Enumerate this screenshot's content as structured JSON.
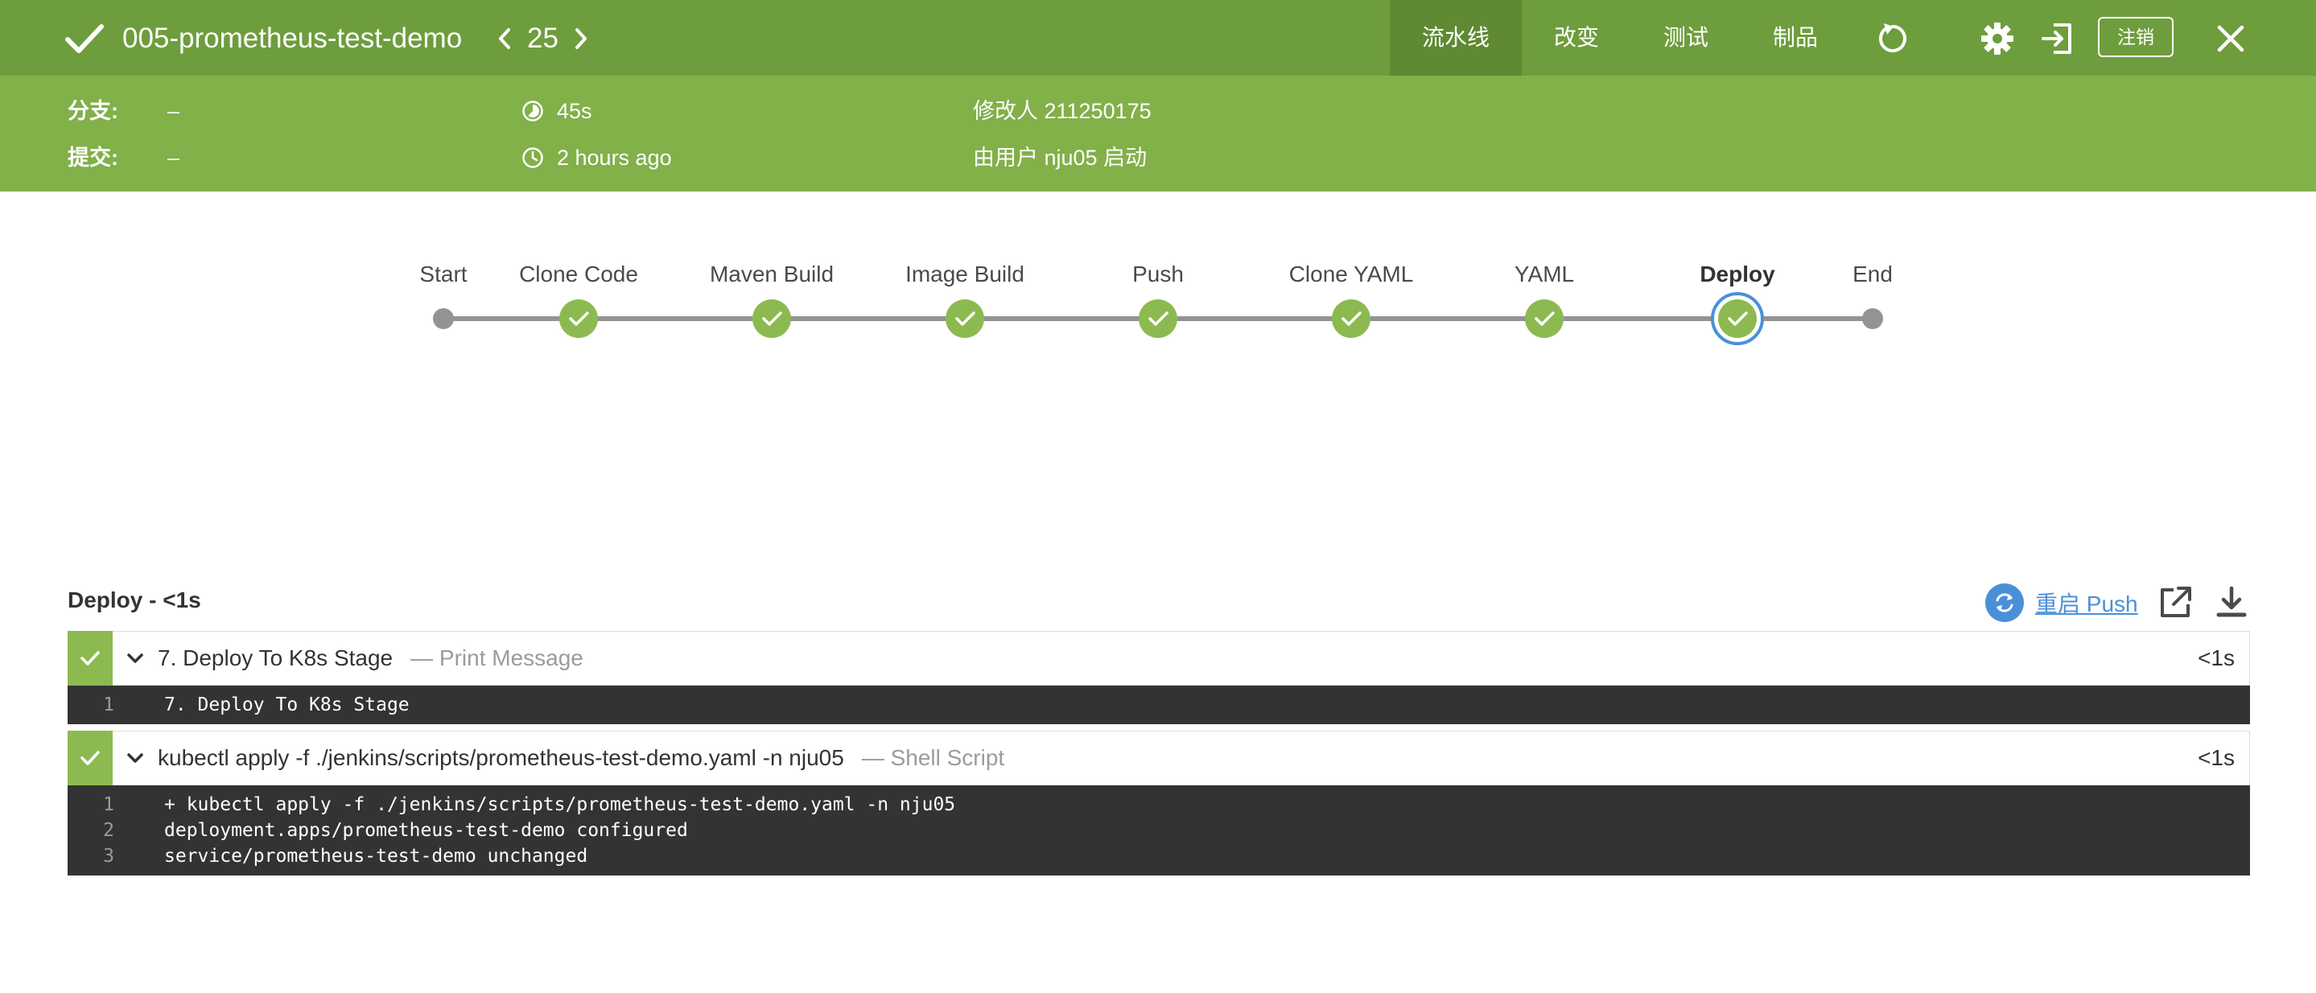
{
  "header": {
    "run_name": "005-prometheus-test-demo",
    "run_number": "25",
    "tabs": [
      {
        "label": "流水线",
        "active": true
      },
      {
        "label": "改变",
        "active": false
      },
      {
        "label": "测试",
        "active": false
      },
      {
        "label": "制品",
        "active": false
      }
    ],
    "logout_label": "注销",
    "icons": [
      "check-icon",
      "chevron-left-icon",
      "chevron-right-icon",
      "replay-icon",
      "gear-icon",
      "exit-icon",
      "close-icon"
    ]
  },
  "summary": {
    "branch_label": "分支:",
    "branch_value": "–",
    "commit_label": "提交:",
    "commit_value": "–",
    "duration": "45s",
    "started": "2 hours ago",
    "changed_by": "修改人 211250175",
    "started_by": "由用户 nju05 启动"
  },
  "pipeline": {
    "stages": [
      {
        "label": "Start",
        "status": "start"
      },
      {
        "label": "Clone Code",
        "status": "success"
      },
      {
        "label": "Maven Build",
        "status": "success"
      },
      {
        "label": "Image Build",
        "status": "success"
      },
      {
        "label": "Push",
        "status": "success"
      },
      {
        "label": "Clone YAML",
        "status": "success"
      },
      {
        "label": "YAML",
        "status": "success"
      },
      {
        "label": "Deploy",
        "status": "success",
        "selected": true
      },
      {
        "label": "End",
        "status": "end"
      }
    ]
  },
  "log": {
    "title": "Deploy - <1s",
    "restart_label": "重启 Push",
    "steps": [
      {
        "name": "7. Deploy To K8s Stage",
        "type": "— Print Message",
        "duration": "<1s",
        "lines": [
          {
            "num": "1",
            "text": "7. Deploy To K8s Stage"
          }
        ]
      },
      {
        "name": "kubectl apply -f ./jenkins/scripts/prometheus-test-demo.yaml -n nju05",
        "type": "— Shell Script",
        "duration": "<1s",
        "lines": [
          {
            "num": "1",
            "text": "+ kubectl apply -f ./jenkins/scripts/prometheus-test-demo.yaml -n nju05"
          },
          {
            "num": "2",
            "text": "deployment.apps/prometheus-test-demo configured"
          },
          {
            "num": "3",
            "text": "service/prometheus-test-demo unchanged"
          }
        ]
      }
    ]
  },
  "colors": {
    "header_bg": "#6e9d3d",
    "subbar_bg": "#82b049",
    "success": "#8cba50",
    "selected_ring": "#4a90d9",
    "console_bg": "#333333"
  }
}
